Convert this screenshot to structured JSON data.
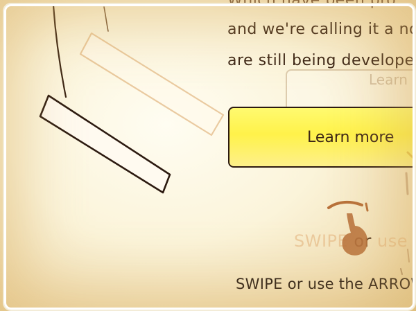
{
  "story": {
    "line_top_partial": "Which have been pro",
    "line_1": "and we're calling it a nove",
    "line_2": "are still being developed. Yo"
  },
  "ghost_button": {
    "label": "Learn"
  },
  "cta": {
    "label": "Learn more",
    "color": "#fff24a"
  },
  "instructions": {
    "faded_left": "SWIPE",
    "faded_or": "or",
    "faded_right": "use th",
    "main": "SWIPE or use the ARROW"
  },
  "icons": {
    "hand": "hand-pointer-icon"
  }
}
